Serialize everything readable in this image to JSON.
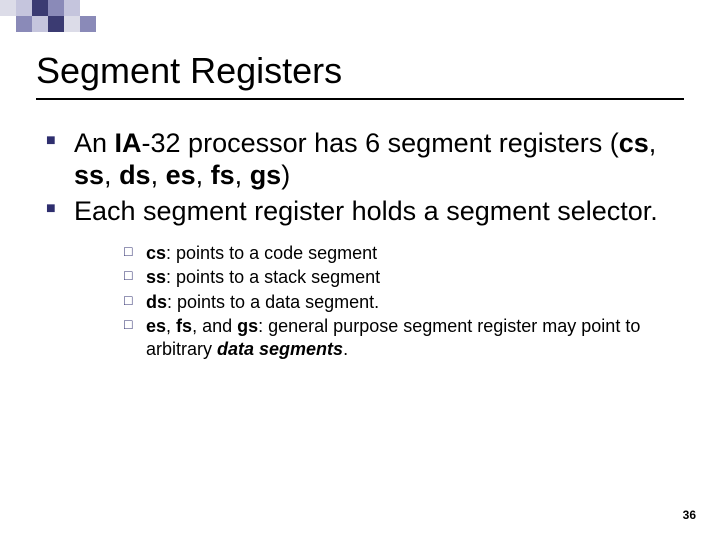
{
  "title": "Segment Registers",
  "bullets": [
    {
      "prefix": "An ",
      "bold1": "IA",
      "mid1": "-32 processor has 6 segment registers (",
      "bold2": "cs",
      "sep1": ", ",
      "bold3": "ss",
      "sep2": ", ",
      "bold4": "ds",
      "sep3": ", ",
      "bold5": "es",
      "sep4": ", ",
      "bold6": "fs",
      "sep5": ", ",
      "bold7": "gs",
      "suffix": ")"
    },
    {
      "text": "Each segment register holds a segment selector."
    }
  ],
  "sub": [
    {
      "b": "cs",
      "rest": ": points to a code segment"
    },
    {
      "b": "ss",
      "rest": ": points to a stack segment"
    },
    {
      "b": "ds",
      "rest": ": points to a data segment."
    },
    {
      "b": "es",
      "mid": ", ",
      "b2": "fs",
      "mid2": ", and ",
      "b3": "gs",
      "rest": ": general purpose segment register may point to arbitrary ",
      "bi": "data segments",
      "tail": "."
    }
  ],
  "pagenum": "36"
}
